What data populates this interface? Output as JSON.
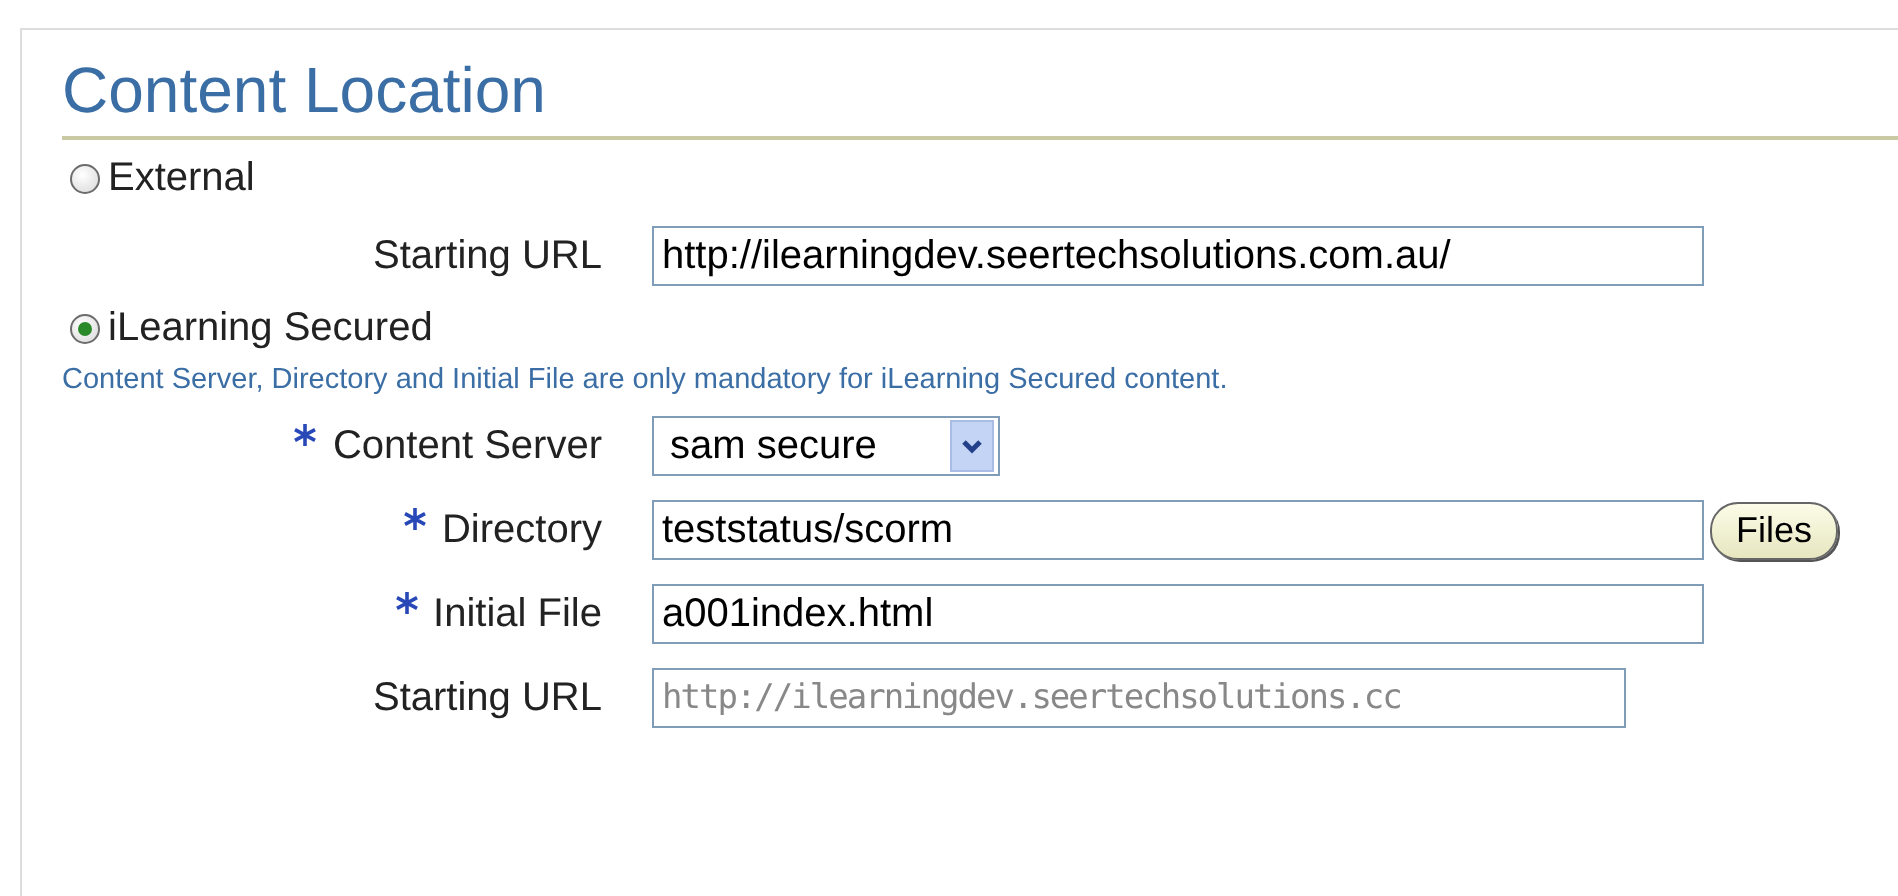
{
  "title": "Content Location",
  "options": [
    {
      "label": "External",
      "selected": false,
      "fields": [
        {
          "kind": "text",
          "label": "Starting URL",
          "required": false,
          "value": "http://ilearningdev.seertechsolutions.com.au/"
        }
      ]
    },
    {
      "label": "iLearning Secured",
      "selected": true,
      "note": "Content Server, Directory and Initial File are only mandatory for iLearning Secured content.",
      "fields": [
        {
          "kind": "select",
          "label": "Content Server",
          "required": true,
          "value": "sam secure"
        },
        {
          "kind": "text",
          "label": "Directory",
          "required": true,
          "value": "teststatus/scorm",
          "button": "Files"
        },
        {
          "kind": "text",
          "label": "Initial File",
          "required": true,
          "value": "a001index.html"
        },
        {
          "kind": "readonly",
          "label": "Starting URL",
          "required": false,
          "value": "http://ilearningdev.seertechsolutions.cc"
        }
      ]
    }
  ]
}
